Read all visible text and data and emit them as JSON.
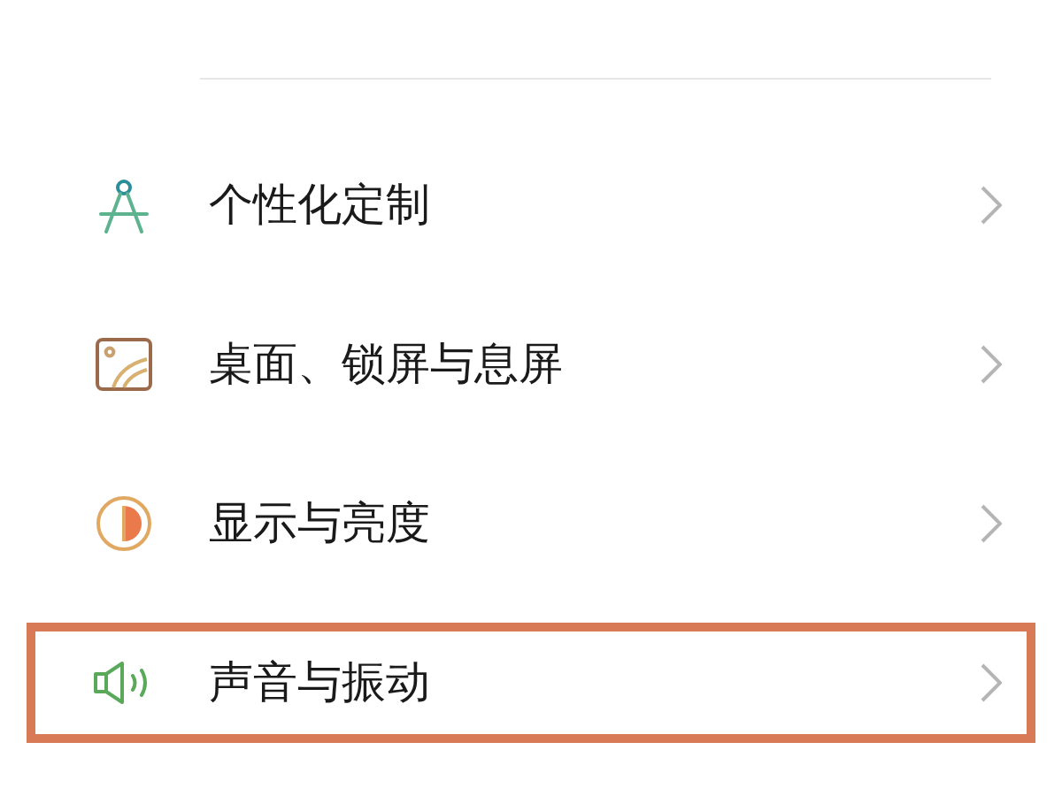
{
  "settings_items": [
    {
      "kind": "compass",
      "label": "个性化定制",
      "highlighted": false
    },
    {
      "kind": "wallpaper",
      "label": "桌面、锁屏与息屏",
      "highlighted": false
    },
    {
      "kind": "display",
      "label": "显示与亮度",
      "highlighted": false
    },
    {
      "kind": "sound",
      "label": "声音与振动",
      "highlighted": true
    }
  ]
}
